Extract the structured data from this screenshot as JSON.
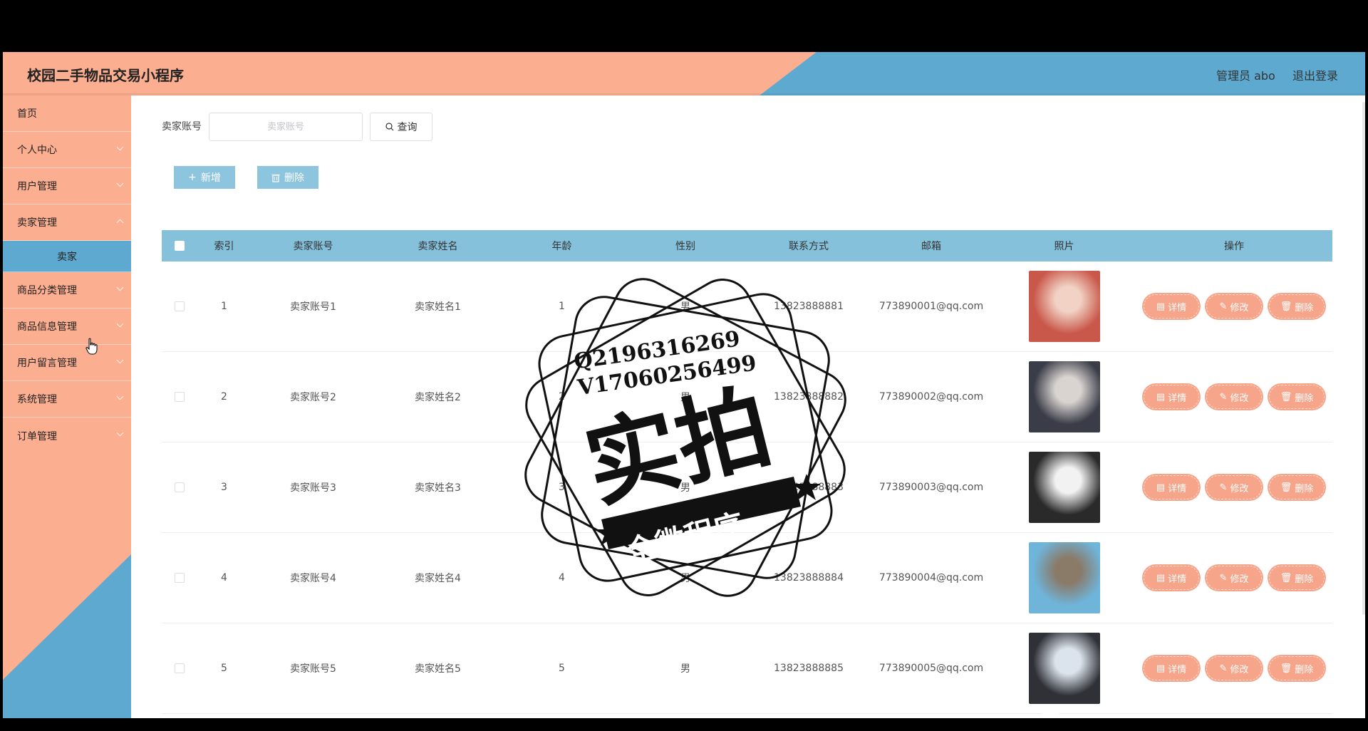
{
  "header": {
    "app_title": "校园二手物品交易小程序",
    "admin_label": "管理员 abo",
    "logout_label": "退出登录"
  },
  "sidebar": {
    "items": [
      {
        "label": "首页"
      },
      {
        "label": "个人中心"
      },
      {
        "label": "用户管理"
      },
      {
        "label": "卖家管理"
      },
      {
        "label": "卖家"
      },
      {
        "label": "商品分类管理"
      },
      {
        "label": "商品信息管理"
      },
      {
        "label": "用户留言管理"
      },
      {
        "label": "系统管理"
      },
      {
        "label": "订单管理"
      }
    ]
  },
  "search": {
    "label": "卖家账号",
    "placeholder": "卖家账号",
    "query_label": "查询"
  },
  "toolbar": {
    "add_label": "新增",
    "delete_label": "删除"
  },
  "table": {
    "columns": [
      "索引",
      "卖家账号",
      "卖家姓名",
      "年龄",
      "性别",
      "联系方式",
      "邮箱",
      "照片",
      "操作"
    ],
    "rows": [
      {
        "index": "1",
        "account": "卖家账号1",
        "name": "卖家姓名1",
        "age": "1",
        "gender": "男",
        "phone": "13823888881",
        "email": "773890001@qq.com"
      },
      {
        "index": "2",
        "account": "卖家账号2",
        "name": "卖家姓名2",
        "age": "2",
        "gender": "男",
        "phone": "13823888882",
        "email": "773890002@qq.com"
      },
      {
        "index": "3",
        "account": "卖家账号3",
        "name": "卖家姓名3",
        "age": "3",
        "gender": "男",
        "phone": "13823888883",
        "email": "773890003@qq.com"
      },
      {
        "index": "4",
        "account": "卖家账号4",
        "name": "卖家姓名4",
        "age": "4",
        "gender": "男",
        "phone": "13823888884",
        "email": "773890004@qq.com"
      },
      {
        "index": "5",
        "account": "卖家账号5",
        "name": "卖家姓名5",
        "age": "5",
        "gender": "男",
        "phone": "13823888885",
        "email": "773890005@qq.com"
      }
    ],
    "actions": {
      "detail": "详情",
      "edit": "修改",
      "delete": "删除"
    }
  },
  "watermark": {
    "qq": "Q2196316269",
    "wechat": "V17060256499",
    "main_text": "实拍",
    "banner_text": "全微程序"
  },
  "colors": {
    "salmon": "#fcae90",
    "blue": "#5ea9cf",
    "table_header": "#85c1db",
    "action_button": "#f6a58a"
  }
}
